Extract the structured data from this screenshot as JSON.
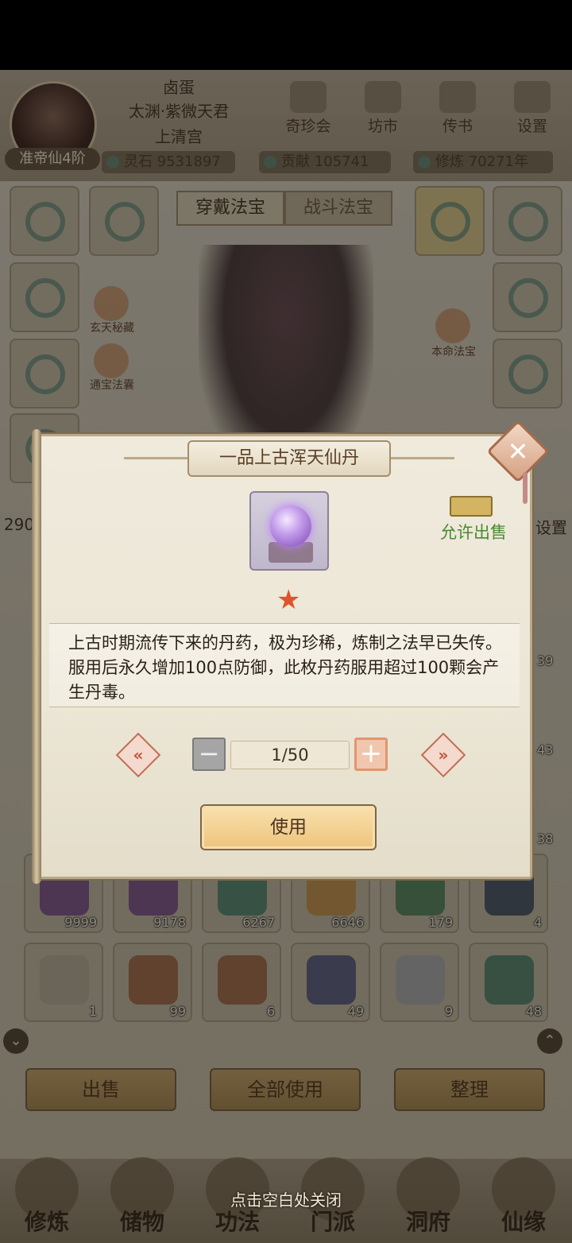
{
  "player": {
    "name": "卤蛋",
    "title": "太渊·紫微天君",
    "sect": "上清宫",
    "rank": "准帝仙4阶"
  },
  "top_menu": [
    {
      "label": "奇珍会",
      "icon": "treasure-pavilion-icon"
    },
    {
      "label": "坊市",
      "icon": "market-icon"
    },
    {
      "label": "传书",
      "icon": "letter-icon"
    },
    {
      "label": "设置",
      "icon": "gear-icon"
    }
  ],
  "resources": {
    "spirit_stone": "灵石 9531897",
    "contribution": "贡献 105741",
    "cultivation": "修炼 70271年"
  },
  "equip_tabs": [
    "穿戴法宝",
    "战斗法宝"
  ],
  "side_labels": {
    "left_top": "玄天秘藏",
    "left_bottom": "通宝法囊",
    "right": "本命法宝"
  },
  "partial_texts": {
    "left_num": "290",
    "right_setting": "设置"
  },
  "inventory": {
    "row_counts_right": [
      "39",
      "43",
      "38"
    ],
    "row1": [
      "9999",
      "9178",
      "6267",
      "6646",
      "179",
      "4"
    ],
    "row2": [
      "1",
      "99",
      "6",
      "49",
      "9",
      "48"
    ]
  },
  "bottom_buttons": [
    "出售",
    "全部使用",
    "整理"
  ],
  "nav": [
    "修炼",
    "储物",
    "功法",
    "门派",
    "洞府",
    "仙缘"
  ],
  "modal": {
    "title": "一品上古浑天仙丹",
    "sell_label": "允许出售",
    "description": "上古时期流传下来的丹药，极为珍稀，炼制之法早已失传。服用后永久增加100点防御，此枚丹药服用超过100颗会产生丹毒。",
    "quantity": "1/50",
    "use_button": "使用",
    "star": "★",
    "close_symbol": "✕",
    "minus_symbol": "−",
    "plus_symbol": "+",
    "prev_symbol": "«",
    "next_symbol": "»"
  },
  "close_hint": "点击空白处关闭",
  "colors": {
    "sell_green": "#4a8a34",
    "star_red": "#e0542b",
    "button_gold": "#edc47c"
  }
}
